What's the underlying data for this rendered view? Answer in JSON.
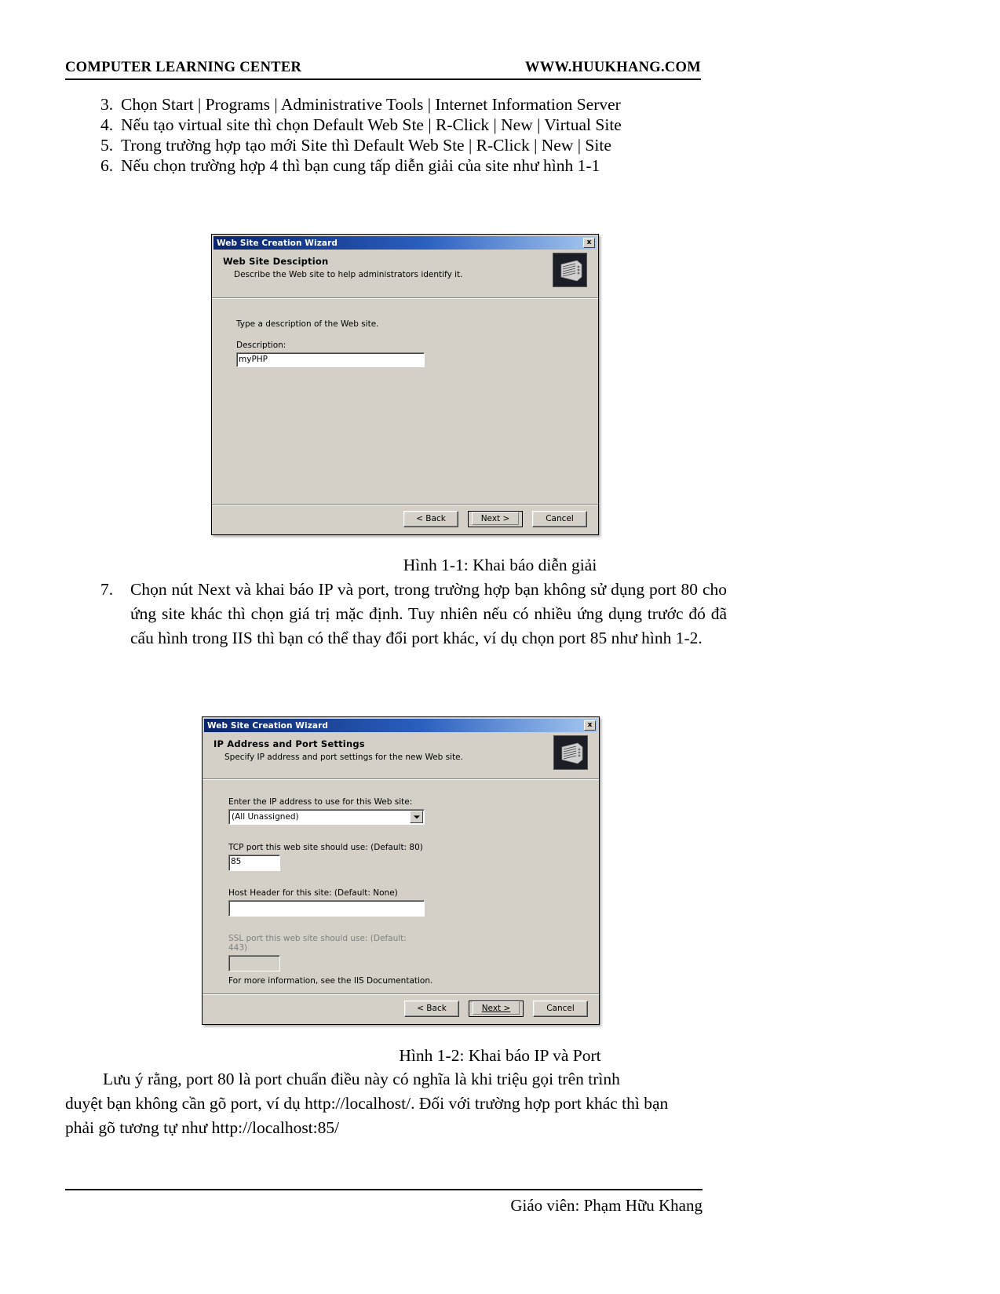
{
  "header": {
    "left": "COMPUTER LEARNING CENTER",
    "right": "WWW.HUUKHANG.COM"
  },
  "steps": [
    {
      "num": "3.",
      "text": "Chọn Start | Programs | Administrative Tools | Internet Information Server"
    },
    {
      "num": "4.",
      "text": "Nếu tạo virtual site thì chọn Default Web Ste | R-Click | New | Virtual Site"
    },
    {
      "num": "5.",
      "text": "Trong trường hợp tạo mới Site thì Default Web Ste | R-Click | New | Site"
    },
    {
      "num": "6.",
      "text": "Nếu chọn trường hợp 4 thì bạn cung tấp diễn giải của site như hình 1-1"
    }
  ],
  "figure1": {
    "caption": "Hình 1-1: Khai báo diễn giải",
    "titlebar": "Web Site Creation Wizard",
    "close_label": "x",
    "banner_head": "Web Site Desciption",
    "banner_sub": "Describe the Web site to help administrators identify it.",
    "prompt": "Type a description of the Web site.",
    "description_label": "Description:",
    "description_value": "myPHP",
    "buttons": {
      "back": "< Back",
      "next": "Next >",
      "cancel": "Cancel"
    }
  },
  "step7": {
    "num": "7.",
    "text": "Chọn nút Next và khai báo IP và port, trong trường hợp bạn không sử dụng port 80 cho ứng site khác thì chọn giá trị mặc định. Tuy nhiên nếu có nhiều ứng dụng trước đó đã cấu hình trong IIS thì bạn có thể thay đổi port khác, ví dụ chọn port 85 như hình 1-2."
  },
  "figure2": {
    "caption": "Hình 1-2: Khai báo IP và Port",
    "titlebar": "Web Site Creation Wizard",
    "close_label": "x",
    "banner_head": "IP Address and Port Settings",
    "banner_sub": "Specify IP address and port settings for the new Web site.",
    "ip_label": "Enter the IP address to use for this Web site:",
    "ip_value": "(All Unassigned)",
    "tcp_label": "TCP port this web site should use: (Default: 80)",
    "tcp_value": "85",
    "host_label": "Host Header for this site: (Default: None)",
    "host_value": "",
    "ssl_label": "SSL port this web site should use: (Default: 443)",
    "ssl_value": "",
    "more_info": "For more information, see the IIS Documentation.",
    "buttons": {
      "back": "< Back",
      "next": "Next >",
      "cancel": "Cancel"
    }
  },
  "note": {
    "line1_indent": "Lưu ý rằng, port 80 là port chuẩn điều này có nghĩa là khi triệu gọi trên trình",
    "line2": "duyệt bạn không cần gõ port, ví dụ http://localhost/. Đối với trường hợp port khác thì bạn",
    "line3": "phải gõ tương tự như http://localhost:85/"
  },
  "footer": {
    "text": "Giáo viên: Phạm Hữu Khang"
  }
}
